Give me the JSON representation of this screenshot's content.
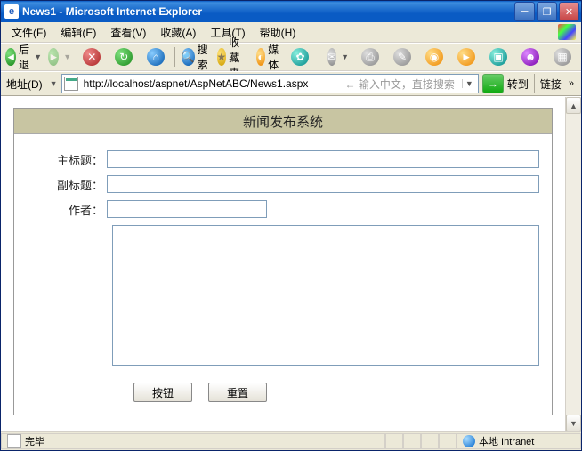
{
  "window": {
    "title": "News1 - Microsoft Internet Explorer",
    "app_icon_letter": "e"
  },
  "menu": {
    "file": "文件(F)",
    "edit": "编辑(E)",
    "view": "查看(V)",
    "favorites": "收藏(A)",
    "tools": "工具(T)",
    "help": "帮助(H)"
  },
  "toolbar": {
    "back": "后退",
    "search": "搜索",
    "favorites": "收藏夹",
    "media": "媒体"
  },
  "addressbar": {
    "label": "地址(D)",
    "url": "http://localhost/aspnet/AspNetABC/News1.aspx",
    "placeholder": "输入中文，直接搜索",
    "go": "转到",
    "links": "链接"
  },
  "form": {
    "header": "新闻发布系统",
    "main_title_label": "主标题：",
    "sub_title_label": "副标题：",
    "author_label": "作者：",
    "main_title_value": "",
    "sub_title_value": "",
    "author_value": "",
    "content_value": "",
    "submit_label": "按钮",
    "reset_label": "重置"
  },
  "status": {
    "done": "完毕",
    "zone": "本地 Intranet"
  }
}
